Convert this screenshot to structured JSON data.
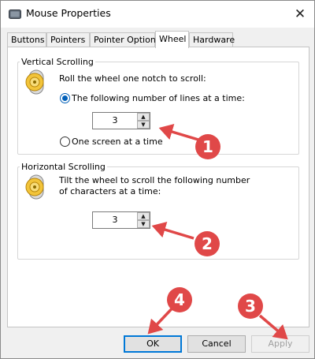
{
  "window": {
    "title": "Mouse Properties",
    "close_glyph": "✕"
  },
  "tabs": [
    {
      "label": "Buttons",
      "active": false
    },
    {
      "label": "Pointers",
      "active": false
    },
    {
      "label": "Pointer Options",
      "active": false
    },
    {
      "label": "Wheel",
      "active": true
    },
    {
      "label": "Hardware",
      "active": false
    }
  ],
  "vertical": {
    "legend": "Vertical Scrolling",
    "intro": "Roll the wheel one notch to scroll:",
    "option_lines": "The following number of lines at a time:",
    "option_screen": "One screen at a time",
    "lines_value": "3",
    "selected": "lines"
  },
  "horizontal": {
    "legend": "Horizontal Scrolling",
    "intro_line1": "Tilt the wheel to scroll the following number",
    "intro_line2": "of characters at a time:",
    "chars_value": "3"
  },
  "buttons": {
    "ok": "OK",
    "cancel": "Cancel",
    "apply": "Apply",
    "apply_enabled": false
  },
  "annotations": {
    "color": "#e04848",
    "badges": [
      "1",
      "2",
      "3",
      "4"
    ]
  },
  "icons": {
    "app": "mouse-properties-icon",
    "wheel": "scroll-wheel-icon",
    "spin_up": "▲",
    "spin_down": "▼"
  }
}
